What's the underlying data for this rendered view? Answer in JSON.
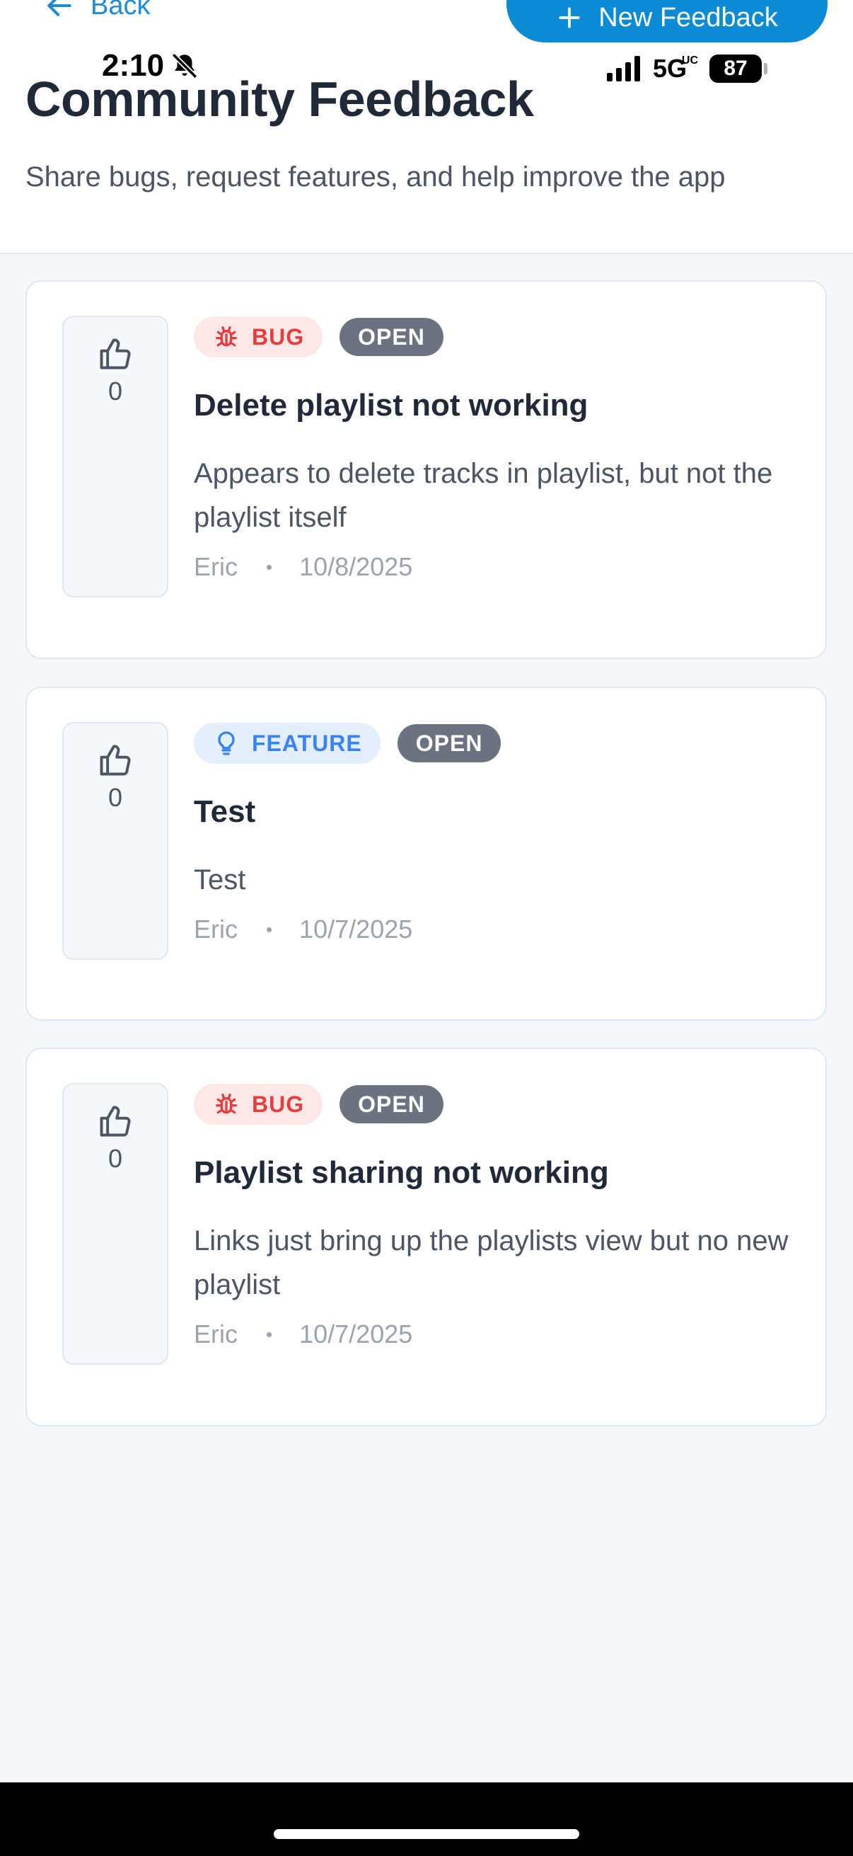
{
  "status_bar": {
    "time": "2:10",
    "network": "5G",
    "network_badge": "UC",
    "battery": "87"
  },
  "header": {
    "back_label": "Back",
    "new_button_label": "New Feedback",
    "title": "Community Feedback",
    "subtitle": "Share bugs, request features, and help improve the app"
  },
  "feedback": [
    {
      "type": "BUG",
      "status": "OPEN",
      "votes": "0",
      "title": "Delete playlist not working",
      "description": "Appears to delete tracks in playlist, but not the playlist itself",
      "author": "Eric",
      "date": "10/8/2025"
    },
    {
      "type": "FEATURE",
      "status": "OPEN",
      "votes": "0",
      "title": "Test",
      "description": "Test",
      "author": "Eric",
      "date": "10/7/2025"
    },
    {
      "type": "BUG",
      "status": "OPEN",
      "votes": "0",
      "title": "Playlist sharing not working",
      "description": "Links just bring up the playlists view but no new playlist",
      "author": "Eric",
      "date": "10/7/2025"
    }
  ],
  "colors": {
    "accent": "#0b8bd3",
    "bug": "#e53e3e",
    "bug_bg": "#fde7e7",
    "feature": "#3b82f6",
    "feature_bg": "#e3effd",
    "status_bg": "#6b7280",
    "page_bg": "#f5f8fc"
  },
  "icons": {
    "back": "arrow-left-icon",
    "new": "plus-icon",
    "vote": "thumbs-up-icon",
    "bug": "bug-icon",
    "feature": "lightbulb-icon",
    "silent": "bell-slash-icon"
  }
}
